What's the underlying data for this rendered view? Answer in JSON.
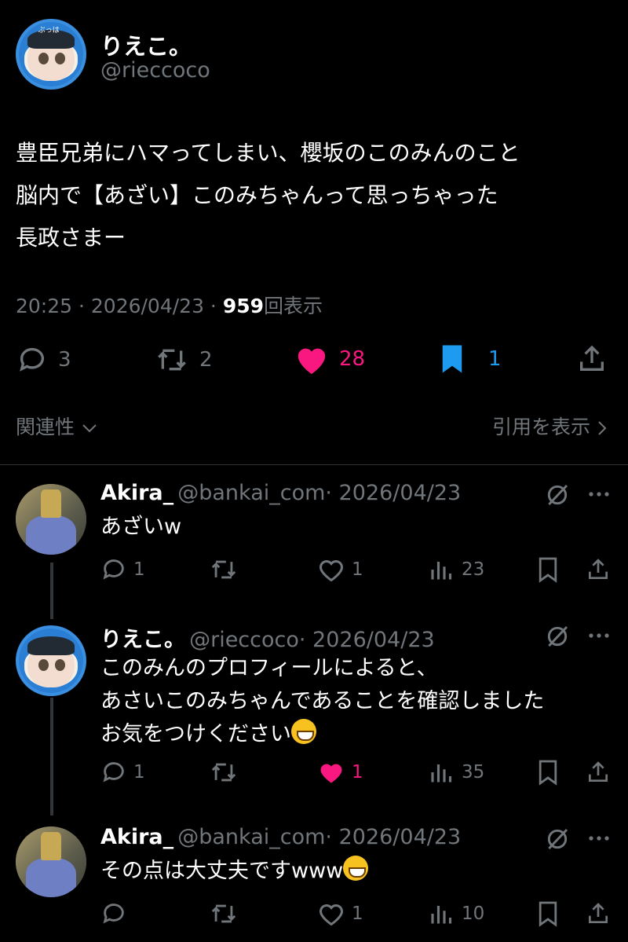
{
  "main_tweet": {
    "author_name": "りえこ。",
    "author_handle": "@rieccoco",
    "avatar_text": "ぶっは",
    "text_lines": [
      "豊臣兄弟にハマってしまい、櫻坂のこのみんのこと",
      "脳内で【あざい】このみちゃんって思っちゃった",
      "長政さまー"
    ],
    "time": "20:25 · 2026/04/23 · ",
    "views": "959",
    "views_suffix": "回表示",
    "replies": "3",
    "retweets": "2",
    "likes": "28",
    "bookmarks": "1",
    "related_label": "関連性",
    "quotes_label": "引用を表示"
  },
  "replies": [
    {
      "name": "Akira_",
      "handle": "@bankai_com",
      "date": "· 2026/04/23",
      "text_lines": [
        "あざいw"
      ],
      "replies": "1",
      "likes": "1",
      "views": "23",
      "liked": false
    },
    {
      "name": "りえこ。",
      "handle": "@rieccoco",
      "date": "· 2026/04/23",
      "text_lines": [
        "このみんのプロフィールによると、",
        "あさいこのみちゃんであることを確認しました",
        "お気をつけください"
      ],
      "replies": "1",
      "likes": "1",
      "views": "35",
      "liked": true
    },
    {
      "name": "Akira_",
      "handle": "@bankai_com",
      "date": "· 2026/04/23",
      "text_lines": [
        "その点は大丈夫ですwww"
      ],
      "replies": "",
      "likes": "1",
      "views": "10",
      "liked": false
    }
  ],
  "colors": {
    "background": "#000000",
    "like_pink": "#f91880",
    "bookmark_blue": "#1d9bf0",
    "muted": "#71767b"
  }
}
